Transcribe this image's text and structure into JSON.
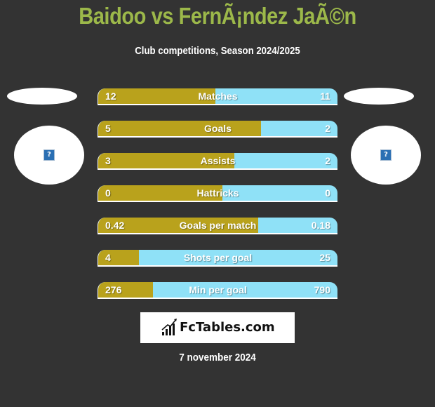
{
  "header": {
    "title": "Baidoo vs FernÃ¡ndez JaÃ©n",
    "subtitle": "Club competitions, Season 2024/2025"
  },
  "players": {
    "left": {
      "avatar_icon": "broken-image-icon",
      "avatar_glyph": "?"
    },
    "right": {
      "avatar_icon": "broken-image-icon",
      "avatar_glyph": "?"
    }
  },
  "colors": {
    "left": "#b9a21c",
    "right": "#8fe1f7",
    "title": "#9cb84a",
    "background": "#333333"
  },
  "stats": [
    {
      "label": "Matches",
      "left": "12",
      "right": "11",
      "left_share": 0.49
    },
    {
      "label": "Goals",
      "left": "5",
      "right": "2",
      "left_share": 0.68
    },
    {
      "label": "Assists",
      "left": "3",
      "right": "2",
      "left_share": 0.57
    },
    {
      "label": "Hattricks",
      "left": "0",
      "right": "0",
      "left_share": 0.52
    },
    {
      "label": "Goals per match",
      "left": "0.42",
      "right": "0.18",
      "left_share": 0.67
    },
    {
      "label": "Shots per goal",
      "left": "4",
      "right": "25",
      "left_share": 0.17
    },
    {
      "label": "Min per goal",
      "left": "276",
      "right": "790",
      "left_share": 0.23
    }
  ],
  "footer": {
    "logo_text": "FcTables.com",
    "date": "7 november 2024"
  }
}
